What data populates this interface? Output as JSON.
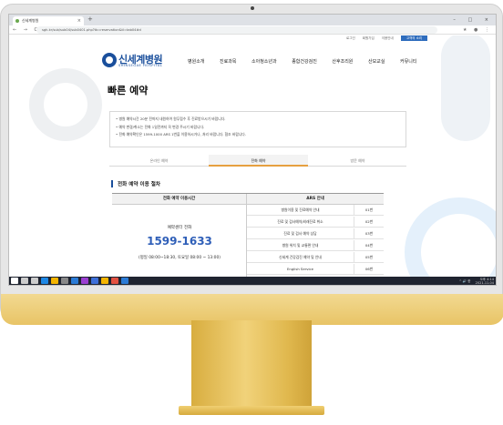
{
  "browser": {
    "tab_title": "신세계병원",
    "tab_close": "×",
    "new_tab": "+",
    "window_controls": "– □ ×",
    "nav_buttons": "← → C",
    "url": "sgh.kr/sub/sub04/sub0401.php?tb=reservation&tl=tab04#d",
    "extensions": "★ ● ⋮"
  },
  "site": {
    "util_links": [
      "로그인",
      "회원가입",
      "이용안내",
      "고객의 소리"
    ],
    "logo_text": "신세계병원",
    "logo_sub": "SHINSEGAE HOSPITAL",
    "nav": [
      "병원소개",
      "진료과목",
      "소아청소년과",
      "종합건강검진",
      "산후조리원",
      "산모교실",
      "커뮤니티"
    ],
    "page_title": "빠른 예약",
    "info_lines": [
      "병원 예약시간 20분 전까지 내원하여 원무접수 후 진료받으시기 바랍니다.",
      "예약 변경/취소는 전화 1일전까지 꼭 변경 주시기 바랍니다.",
      "전화 예약확인은 1599-1000 ARS 1번을 이용하시거나, 처리 바랍니다. 협조 바랍니다."
    ],
    "tabs": [
      "온라인 예약",
      "전화 예약",
      "방문 예약"
    ],
    "active_tab": 1,
    "section_title": "전화 예약 이용 절차",
    "table": {
      "head_left": "전화 예약 이용시간",
      "head_right": "ARS 안내",
      "center_label": "예약센터 전화",
      "phone": "1599-1633",
      "hours": "(평일 08:00~18:30, 토요일 08:00 ~ 13:00)",
      "ars": [
        {
          "label": "병원이용 및 진료예약 안내",
          "num": "01번"
        },
        {
          "label": "진료 및 검사예약/외래진료 취소",
          "num": "02번"
        },
        {
          "label": "진료 및 검사 예약 상담",
          "num": "03번"
        },
        {
          "label": "병원 위치 및 교통편 안내",
          "num": "04번"
        },
        {
          "label": "신세계 건강검진 예약 및 안내",
          "num": "05번"
        },
        {
          "label": "English Service",
          "num": "06번"
        }
      ]
    }
  },
  "taskbar": {
    "icons": [
      "windows-start",
      "search",
      "task-view",
      "edge",
      "file-explorer",
      "store",
      "vscode",
      "app-purple",
      "app-blue",
      "app-yellow",
      "chrome",
      "app-blue2"
    ],
    "icon_colors": [
      "#ffffff",
      "#cccccc",
      "#cccccc",
      "#1e88e5",
      "#f4b400",
      "#888888",
      "#2b7bd6",
      "#9b3fd1",
      "#3d6fd9",
      "#f4b400",
      "#e25141",
      "#2b7bd6"
    ],
    "tray_text": "^ 🔊 한",
    "time": "오후 4:14",
    "date": "2021-11-04"
  },
  "colors": {
    "brand": "#1a4f9c",
    "phone": "#2f5fb8",
    "tab_underline": "#e6a040",
    "monitor_gold": "#e8c466"
  }
}
